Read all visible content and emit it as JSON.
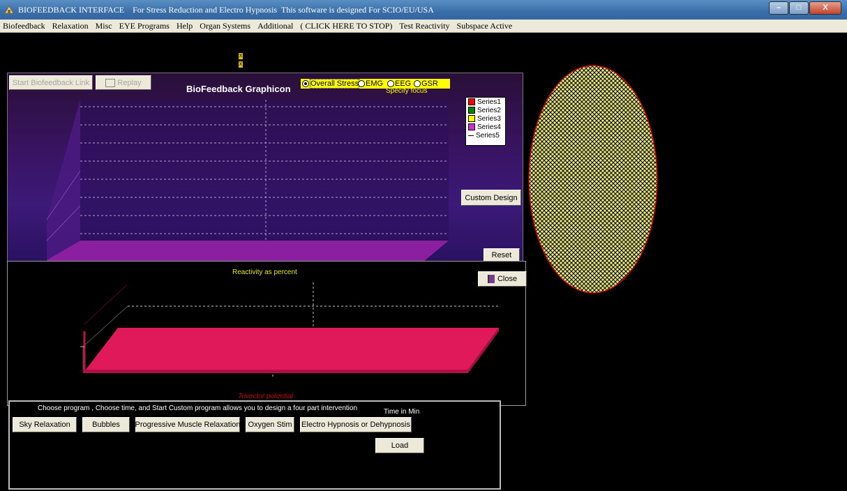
{
  "window": {
    "title": "BIOFEEDBACK INTERFACE    For Stress Reduction and Electro Hypnosis  This software is designed For SCIO/EU/USA",
    "controls": {
      "minimize": "–",
      "maximize": "□",
      "close": "X"
    }
  },
  "menu": [
    "Biofeedback",
    "Relaxation",
    "Misc",
    "EYE Programs",
    "Help",
    "Organ Systems",
    "Additional",
    "( CLICK HERE TO STOP)",
    "Test Reactivity",
    "Subspace Active"
  ],
  "markers": [
    "X",
    "X"
  ],
  "graph": {
    "start_button": "Start Biofeedback Link",
    "replay_button": "Replay",
    "title": "BioFeedback Graphicon",
    "focus_options": [
      {
        "label": "Overall Stress",
        "selected": true
      },
      {
        "label": "EMG",
        "selected": false
      },
      {
        "label": "EEG",
        "selected": false
      },
      {
        "label": "GSR",
        "selected": false
      }
    ],
    "focus_caption": "Specify focus",
    "legend": [
      {
        "name": "Series1",
        "color": "#ff0000"
      },
      {
        "name": "Series2",
        "color": "#008000"
      },
      {
        "name": "Series3",
        "color": "#ffff00"
      },
      {
        "name": "Series4",
        "color": "#cc33cc"
      },
      {
        "name": "Series5",
        "color": "#000000"
      }
    ],
    "custom_design_button": "Custom Design",
    "reset_button": "Reset"
  },
  "reactivity": {
    "title": "Reactivity as percent",
    "close_button": "Close",
    "footer": "Trivector potential"
  },
  "programs": {
    "instructions": "Choose program , Choose time, and Start   Custom program allows you to design a four part intervention",
    "time_label": "Time in Min",
    "buttons": [
      "Sky Relaxation",
      "Bubbles",
      "Progressive Muscle Relaxation",
      "Oxygen Stim",
      "Electro Hypnosis or Dehypnosis"
    ],
    "load_button": "Load"
  },
  "colors": {
    "oval_fill": "#e8e87a",
    "oval_border": "#cc0000",
    "reactivity_bar": "#e0195a"
  }
}
